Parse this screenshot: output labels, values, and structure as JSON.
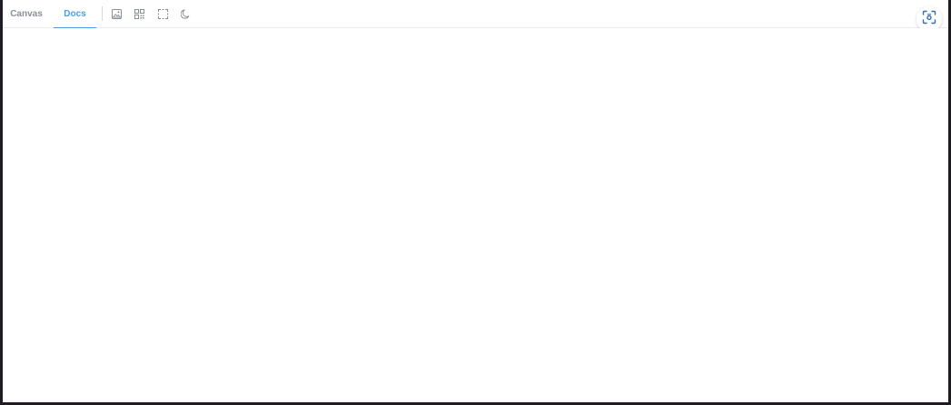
{
  "tabs": [
    {
      "label": "Canvas",
      "active": false
    },
    {
      "label": "Docs",
      "active": true
    }
  ],
  "toolbar_icons": [
    "image-icon",
    "qr-code-icon",
    "select-frame-icon",
    "dark-mode-moon-icon"
  ],
  "capture_icon": "screenshot-capture-icon",
  "colors": {
    "accent": "#4a9ee8",
    "tab_inactive": "#8a8f96",
    "icon": "#8a8f96",
    "capture_icon": "#2f6fb6"
  }
}
